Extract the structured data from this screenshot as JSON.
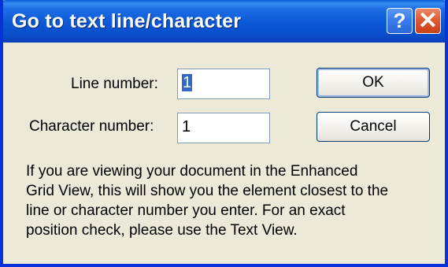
{
  "window": {
    "title": "Go to text line/character",
    "help_label": "?",
    "close_label": "✕"
  },
  "form": {
    "line_label": "Line number:",
    "line_value": "1",
    "char_label": "Character number:",
    "char_value": "1"
  },
  "buttons": {
    "ok_label": "OK",
    "cancel_label": "Cancel"
  },
  "info": {
    "lines": [
      "If you are viewing your document in the Enhanced",
      "Grid View, this will show you the element closest to the",
      "line or character number you enter. For an exact",
      "position check, please use the Text View."
    ]
  },
  "colors": {
    "titlebar": "#0a58d6",
    "dialog_bg": "#ece9d8",
    "close_button": "#e05a32",
    "help_button": "#3b7ce9",
    "selection": "#316ac5"
  }
}
